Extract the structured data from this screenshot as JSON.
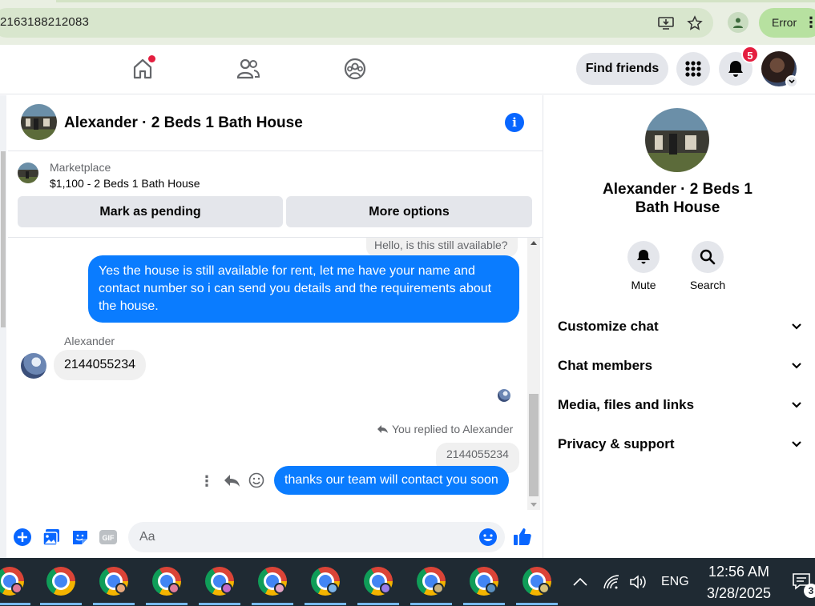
{
  "browser": {
    "url": "2163188212083",
    "error_label": "Error"
  },
  "nav": {
    "find_friends_label": "Find friends",
    "notification_count": "5"
  },
  "chat": {
    "title": "Alexander · 2 Beds 1 Bath House",
    "listing": {
      "source_label": "Marketplace",
      "price_title": "$1,100 - 2 Beds 1 Bath House",
      "mark_pending_label": "Mark as pending",
      "more_options_label": "More options"
    },
    "messages": {
      "top_quoted": "Hello, is this still available?",
      "outgoing_1": "Yes the house is still available for rent, let me have your name and contact number so i can send you details and the requirements about the house.",
      "sender_name": "Alexander",
      "incoming_1": "2144055234",
      "replied_to_label": "You replied to Alexander",
      "reply_quote": "2144055234",
      "outgoing_2": "thanks our team will contact you soon"
    },
    "composer": {
      "placeholder": "Aa"
    }
  },
  "info_panel": {
    "title": "Alexander · 2 Beds 1 Bath House",
    "mute_label": "Mute",
    "search_label": "Search",
    "sections": [
      "Customize chat",
      "Chat members",
      "Media, files and links",
      "Privacy & support"
    ]
  },
  "taskbar": {
    "language": "ENG",
    "time": "12:56 AM",
    "date": "3/28/2025",
    "notif_count": "3"
  },
  "colors": {
    "messenger_blue": "#0a7cff",
    "fb_blue": "#0866ff",
    "badge_red": "#e41e3f"
  }
}
